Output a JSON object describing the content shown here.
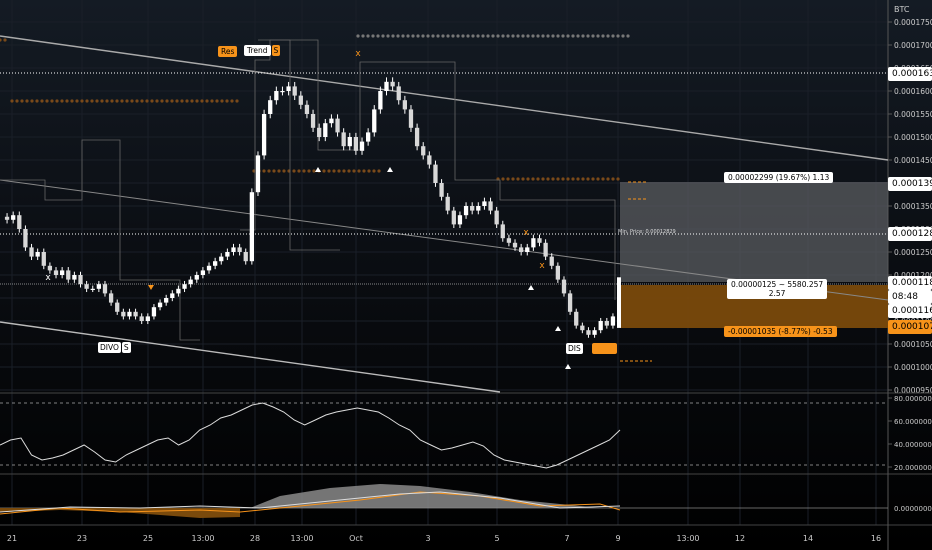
{
  "symbol": "BTC",
  "colors": {
    "accent": "#f7931a",
    "candle_up": "#ffffff",
    "candle_down": "#ffffff",
    "grid": "#1a1f28",
    "price_line": "#ffffff"
  },
  "price_axis": {
    "ticks": [
      "0.00017500",
      "0.00017000",
      "0.00016500",
      "0.00016000",
      "0.00015500",
      "0.00015000",
      "0.00014500",
      "0.00014000",
      "0.00013500",
      "0.00013000",
      "0.00012500",
      "0.00012000",
      "0.00011500",
      "0.00011000",
      "0.00010500",
      "0.00010000",
      "0.00009500"
    ],
    "labels": {
      "high_line": "0.00016388",
      "box_top": "0.00013985",
      "mid_line": "0.00012829",
      "current": "0.00011812",
      "countdown": "08:48",
      "lower": "0.00011687",
      "orange_price": "0.00010791"
    }
  },
  "time_axis": [
    "21",
    "23",
    "25",
    "13:00",
    "28",
    "13:00",
    "Oct",
    "3",
    "5",
    "7",
    "9",
    "13:00",
    "12",
    "14",
    "16"
  ],
  "osc1_axis": [
    "80.00000000",
    "60.00000000",
    "40.00000000",
    "20.00000000"
  ],
  "osc2_axis": [
    "0.00000000"
  ],
  "measure": {
    "upper_tooltip": "0.00002299 (19.67%) 1.13",
    "mid_tooltip_line1": "0.00000125 ~ 5580.257",
    "mid_tooltip_line2": "2.57",
    "lower_tooltip": "-0.00001035 (-8.77%) -0.53",
    "min_label": "Min. Price: 0.00012829"
  },
  "markers": {
    "trend": "Trend",
    "trend_tag": "S",
    "orange_tag": "Res",
    "divo": "DIVO",
    "s_tag": "S",
    "dis": "DIS",
    "x": "x"
  }
}
